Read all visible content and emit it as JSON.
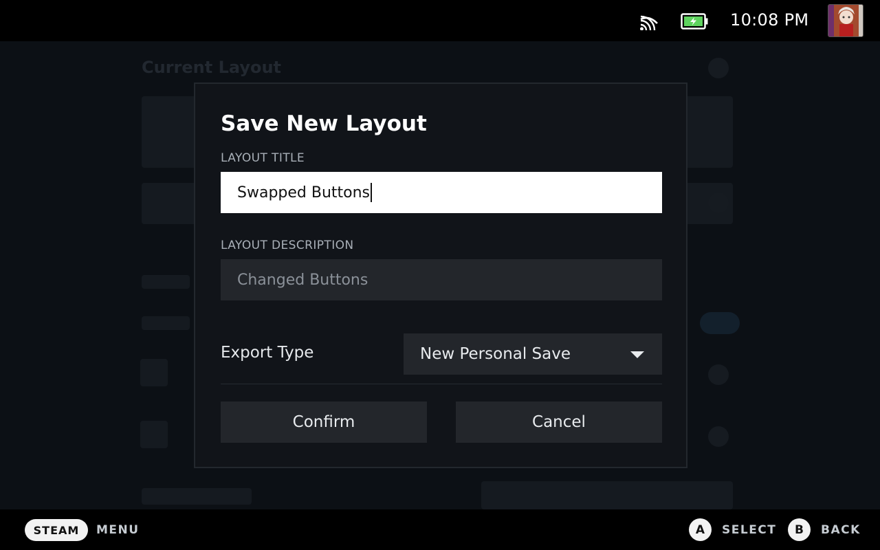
{
  "status_bar": {
    "time": "10:08 PM",
    "icons": [
      "wifi-icon",
      "battery-charging-icon",
      "avatar"
    ]
  },
  "background": {
    "section_title": "Current Layout"
  },
  "modal": {
    "title": "Save New Layout",
    "layout_title_label": "LAYOUT TITLE",
    "layout_title_value": "Swapped Buttons",
    "layout_description_label": "LAYOUT DESCRIPTION",
    "layout_description_placeholder": "Changed Buttons",
    "export_type_label": "Export Type",
    "export_type_value": "New Personal Save",
    "confirm_label": "Confirm",
    "cancel_label": "Cancel"
  },
  "bottom_bar": {
    "steam_label": "STEAM",
    "menu_label": "MENU",
    "a_glyph": "A",
    "select_label": "SELECT",
    "b_glyph": "B",
    "back_label": "BACK"
  },
  "colors": {
    "modal_bg": "#111419",
    "input_bg": "#23262b",
    "title_input_bg": "#ffffff",
    "battery_green": "#5fd35f"
  }
}
